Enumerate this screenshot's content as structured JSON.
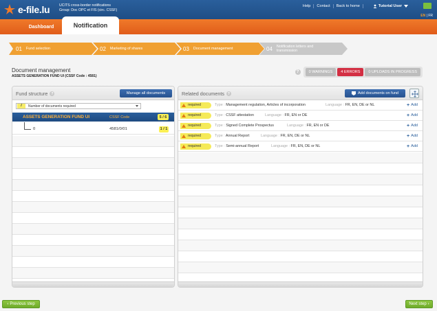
{
  "header": {
    "logo_text": "e-file.lu",
    "subtitle_line1": "UCITS cross-border notifications",
    "subtitle_line2": "Group: Doc OPC et FIS (circ. CSSF)",
    "links": [
      "Help",
      "Contact",
      "Back to home"
    ],
    "user_label": "Tutorial User",
    "languages": [
      "EN",
      "FR"
    ],
    "active_language": "EN",
    "colors": {
      "primary": "#1f4e85",
      "accent": "#e86a22",
      "success": "#7bbf3e"
    }
  },
  "tabs": {
    "dashboard": "Dashboard",
    "notification": "Notification"
  },
  "steps": [
    {
      "num": "01",
      "label": "Fund selection"
    },
    {
      "num": "02",
      "label": "Marketing of shares"
    },
    {
      "num": "03",
      "label": "Document management"
    },
    {
      "num": "04",
      "label": "Notification letters and transmission"
    }
  ],
  "page": {
    "title": "Document management",
    "subtitle": "ASSETS GENERATION FUND UI (CSSF Code : 4581)",
    "warnings": "0 WARNINGS",
    "errors": "4 ERRORS",
    "uploads": "0 UPLOADS IN PROGRESS"
  },
  "fund_structure": {
    "title": "Fund structure",
    "manage_button": "Manage all documents",
    "filter_symbol": "/",
    "filter_label": "Number of documents required",
    "fund_name": "ASSETS GENERATION FUND UI",
    "code_header": "CSSF Code",
    "fund_count": "5 / 6",
    "sub": {
      "name": "0",
      "code": "4581/0/01",
      "count": "1 / 1"
    }
  },
  "related_documents": {
    "title": "Related documents",
    "add_button": "Add documents on fund",
    "required_label": "required",
    "type_label": "Type :",
    "language_label": "Language :",
    "add_label": "Add",
    "rows": [
      {
        "type": "Management regulation, Articles of incorporation",
        "language": "FR, EN, DE or NL"
      },
      {
        "type": "CSSF attestation",
        "language": "FR, EN or DE"
      },
      {
        "type": "Signed Complete Prospectus",
        "language": "FR, EN or DE"
      },
      {
        "type": "Annual Report",
        "language": "FR, EN, DE or NL"
      },
      {
        "type": "Semi-annual Report",
        "language": "FR, EN, DE or NL"
      }
    ]
  },
  "nav": {
    "prev": "Previous step",
    "next": "Next step"
  }
}
